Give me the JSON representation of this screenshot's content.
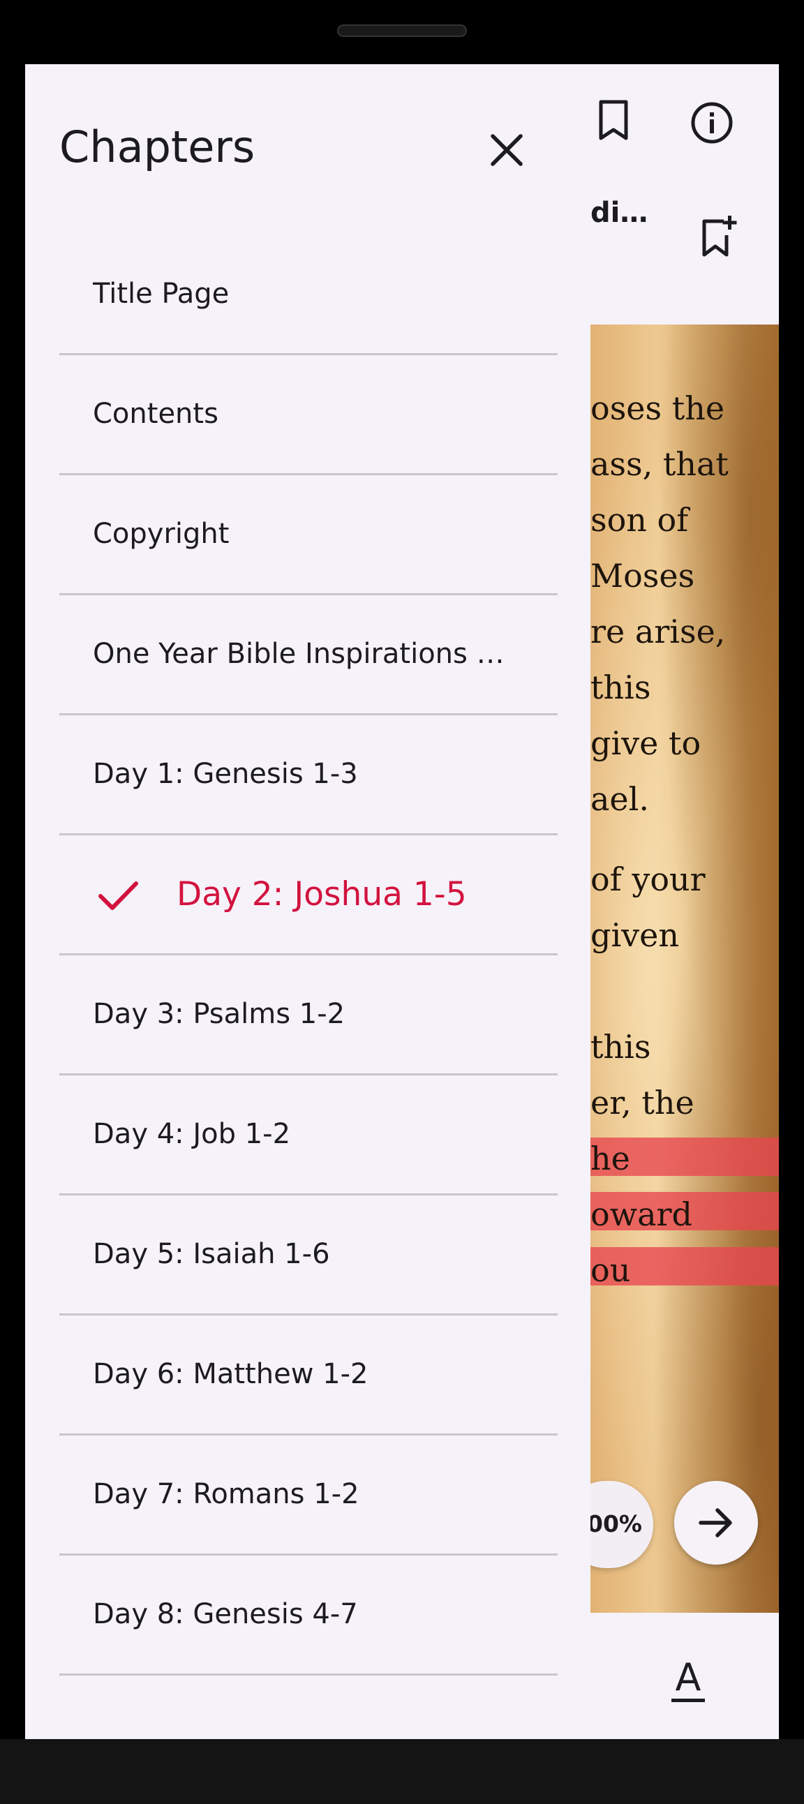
{
  "drawer": {
    "title": "Chapters",
    "chapters": [
      {
        "label": "Title Page"
      },
      {
        "label": "Contents"
      },
      {
        "label": "Copyright"
      },
      {
        "label": "One Year Bible Inspirations – …"
      },
      {
        "label": "Day 1: Genesis 1-3"
      },
      {
        "label": "Day 2: Joshua 1-5",
        "selected": true
      },
      {
        "label": "Day 3: Psalms 1-2"
      },
      {
        "label": "Day 4: Job 1-2"
      },
      {
        "label": "Day 5: Isaiah 1-6"
      },
      {
        "label": "Day 6: Matthew 1-2"
      },
      {
        "label": "Day 7: Romans 1-2"
      },
      {
        "label": "Day 8: Genesis 4-7"
      }
    ],
    "accent_color": "#d2123e"
  },
  "reader": {
    "header_title_fragment": "di…",
    "page_lines": [
      "oses the",
      "ass, that",
      "son of",
      " Moses",
      "re arise,",
      " this",
      "give to",
      "ael.",
      "of your",
      " given",
      "",
      " this",
      "er, the",
      "he",
      "oward",
      "ou"
    ],
    "progress_fragment": "00%",
    "font_button_label": "A",
    "icons": [
      "bookmark-icon",
      "info-icon",
      "bookmark-add-icon",
      "arrow-forward-icon",
      "text-format-icon"
    ]
  }
}
